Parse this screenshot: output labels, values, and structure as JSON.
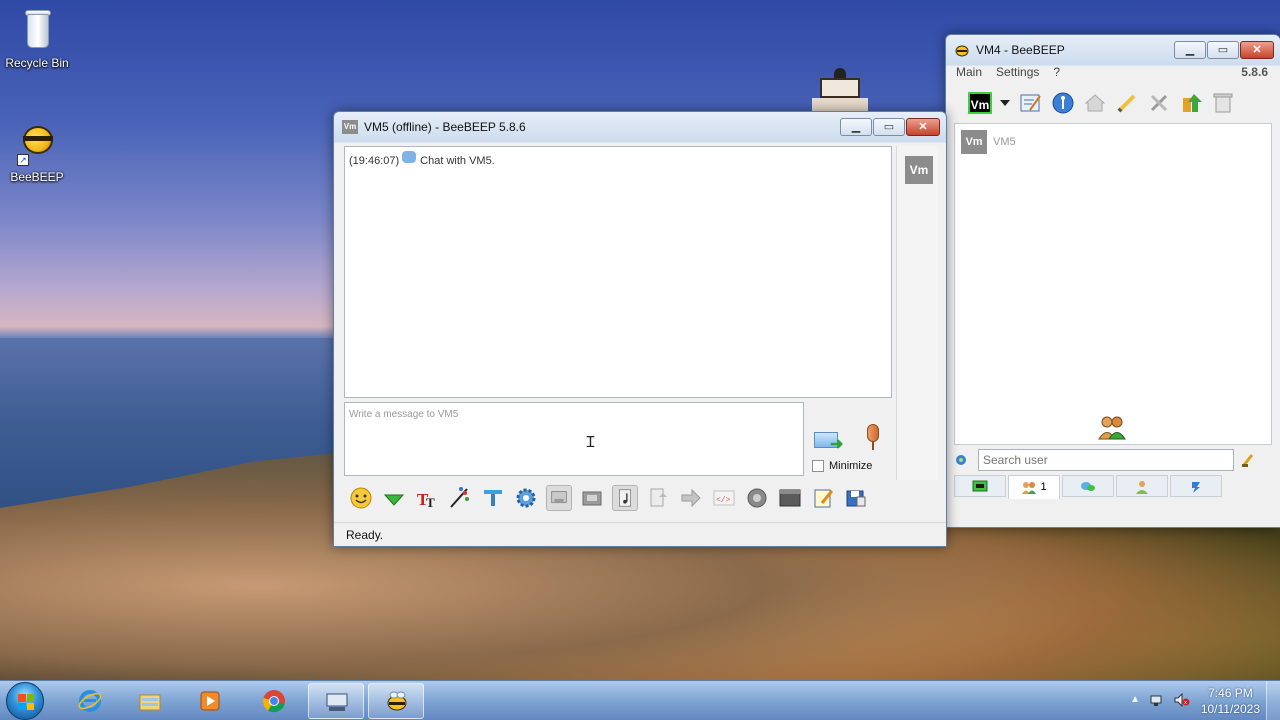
{
  "desktop": {
    "icons": [
      {
        "label": "Recycle Bin",
        "icon": "recycle-bin-icon"
      },
      {
        "label": "BeeBEEP",
        "icon": "beebeep-icon"
      }
    ]
  },
  "chat_window": {
    "title": "VM5 (offline) - BeeBEEP 5.8.6",
    "title_icon_text": "Vm",
    "messages": [
      {
        "time": "(19:46:07)",
        "text": "Chat with VM5."
      }
    ],
    "user_avatar": "Vm",
    "input_placeholder": "Write a message to VM5",
    "minimize_label": "Minimize",
    "status": "Ready.",
    "toolbar_icons": [
      "emoticon-icon",
      "green-arrow-icon",
      "text-font-icon",
      "text-color-icon",
      "filter-icon",
      "settings-gear-icon",
      "save-icon",
      "print-icon",
      "music-note-icon",
      "send-file-icon",
      "forward-icon",
      "html-code-icon",
      "screenshot-icon",
      "terminal-icon",
      "edit-note-icon",
      "share-icon"
    ]
  },
  "main_window": {
    "title": "VM4 - BeeBEEP",
    "menu": [
      "Main",
      "Settings",
      "?"
    ],
    "version": "5.8.6",
    "status_badge": "Vm",
    "users": [
      {
        "avatar": "Vm",
        "name": "VM5"
      }
    ],
    "search_placeholder": "Search user",
    "tabs": [
      {
        "icon": "green-screen-icon",
        "label": ""
      },
      {
        "icon": "users-icon",
        "label": "1"
      },
      {
        "icon": "chats-icon",
        "label": ""
      },
      {
        "icon": "groups-icon",
        "label": ""
      },
      {
        "icon": "shares-icon",
        "label": ""
      }
    ]
  },
  "taskbar": {
    "apps": [
      "internet-explorer-icon",
      "file-explorer-icon",
      "media-player-icon",
      "chrome-icon",
      "keyboard-app-icon",
      "beebeep-taskbar-icon"
    ],
    "time": "7:46 PM",
    "date": "10/11/2023"
  },
  "colors": {
    "accent_blue": "#2f8fd8",
    "online_green": "#3ad23a",
    "close_red": "#c7432a"
  }
}
